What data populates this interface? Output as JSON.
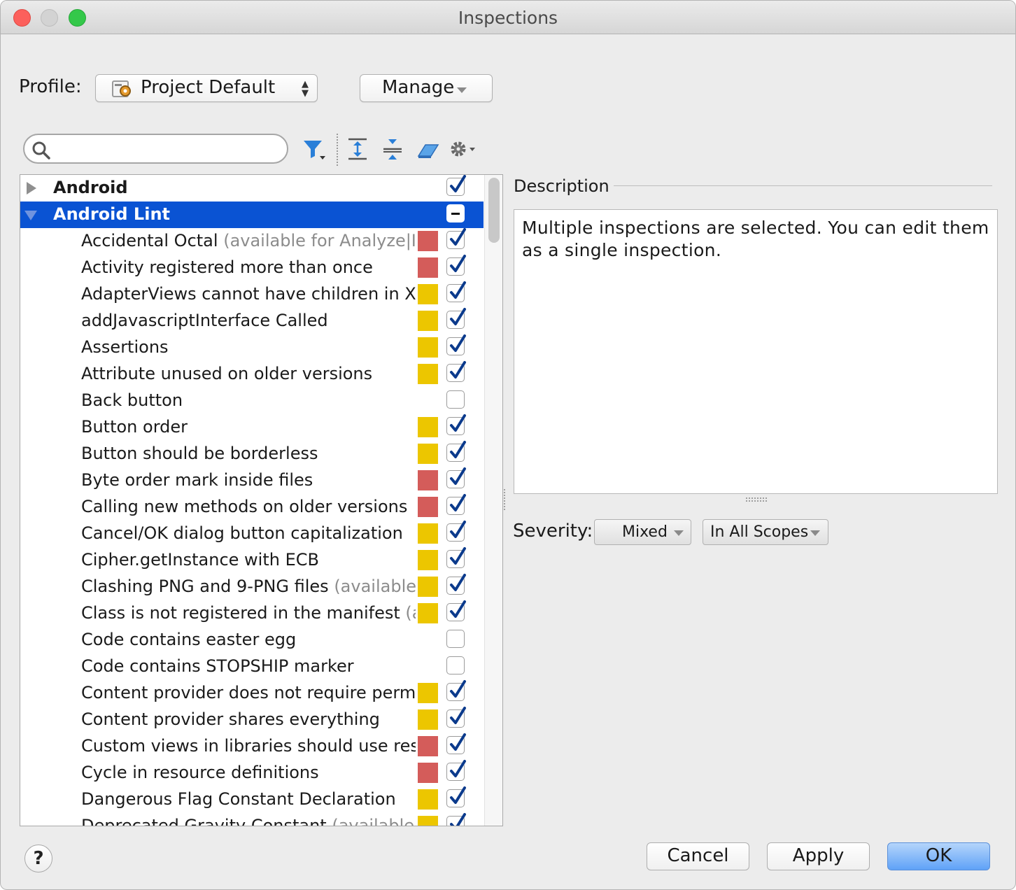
{
  "window": {
    "title": "Inspections"
  },
  "profile": {
    "label": "Profile:",
    "selected": "Project Default",
    "manage_label": "Manage"
  },
  "search": {
    "placeholder": "",
    "value": ""
  },
  "toolbar": {
    "icons": [
      "filter-icon",
      "expand-all-icon",
      "collapse-all-icon",
      "reset-eraser-icon",
      "gear-icon"
    ]
  },
  "tree": {
    "groups": [
      {
        "label": "Android",
        "expanded": false,
        "checked": "checked"
      },
      {
        "label": "Android Lint",
        "expanded": true,
        "checked": "mixed",
        "selected": true
      }
    ],
    "items": [
      {
        "label": "Accidental Octal",
        "note": "(available for Analyze|Inspect Code)",
        "severity": "error",
        "checked": true
      },
      {
        "label": "Activity registered more than once",
        "note": "",
        "severity": "error",
        "checked": true
      },
      {
        "label": "AdapterViews cannot have children in XML",
        "note": "",
        "severity": "warning",
        "checked": true
      },
      {
        "label": "addJavascriptInterface Called",
        "note": "",
        "severity": "warning",
        "checked": true
      },
      {
        "label": "Assertions",
        "note": "",
        "severity": "warning",
        "checked": true
      },
      {
        "label": "Attribute unused on older versions",
        "note": "",
        "severity": "warning",
        "checked": true
      },
      {
        "label": "Back button",
        "note": "",
        "severity": "none",
        "checked": false
      },
      {
        "label": "Button order",
        "note": "",
        "severity": "warning",
        "checked": true
      },
      {
        "label": "Button should be borderless",
        "note": "",
        "severity": "warning",
        "checked": true
      },
      {
        "label": "Byte order mark inside files",
        "note": "",
        "severity": "error",
        "checked": true
      },
      {
        "label": "Calling new methods on older versions",
        "note": "",
        "severity": "error",
        "checked": true
      },
      {
        "label": "Cancel/OK dialog button capitalization",
        "note": "",
        "severity": "warning",
        "checked": true
      },
      {
        "label": "Cipher.getInstance with ECB",
        "note": "",
        "severity": "warning",
        "checked": true
      },
      {
        "label": "Clashing PNG and 9-PNG files",
        "note": "(available for Analyze|Inspect Code)",
        "severity": "warning",
        "checked": true
      },
      {
        "label": "Class is not registered in the manifest",
        "note": "(available for Analyze|Inspect Code)",
        "severity": "warning",
        "checked": true
      },
      {
        "label": "Code contains easter egg",
        "note": "",
        "severity": "none",
        "checked": false
      },
      {
        "label": "Code contains STOPSHIP marker",
        "note": "",
        "severity": "none",
        "checked": false
      },
      {
        "label": "Content provider does not require permission",
        "note": "",
        "severity": "warning",
        "checked": true
      },
      {
        "label": "Content provider shares everything",
        "note": "",
        "severity": "warning",
        "checked": true
      },
      {
        "label": "Custom views in libraries should use res-auto-namespace",
        "note": "",
        "severity": "error",
        "checked": true
      },
      {
        "label": "Cycle in resource definitions",
        "note": "",
        "severity": "error",
        "checked": true
      },
      {
        "label": "Dangerous Flag Constant Declaration",
        "note": "",
        "severity": "warning",
        "checked": true
      },
      {
        "label": "Deprecated Gravity Constant",
        "note": "(available for Analyze|Inspect Code)",
        "severity": "warning",
        "checked": true
      }
    ]
  },
  "description": {
    "title": "Description",
    "text": "Multiple inspections are selected. You can edit them as a single inspection."
  },
  "severity": {
    "label": "Severity:",
    "level": "Mixed",
    "scope": "In All Scopes"
  },
  "buttons": {
    "help": "?",
    "cancel": "Cancel",
    "apply": "Apply",
    "ok": "OK"
  },
  "colors": {
    "error": "#d45c5a",
    "warning": "#ecc600",
    "selection": "#0a53d3",
    "check": "#0b3a8c"
  }
}
